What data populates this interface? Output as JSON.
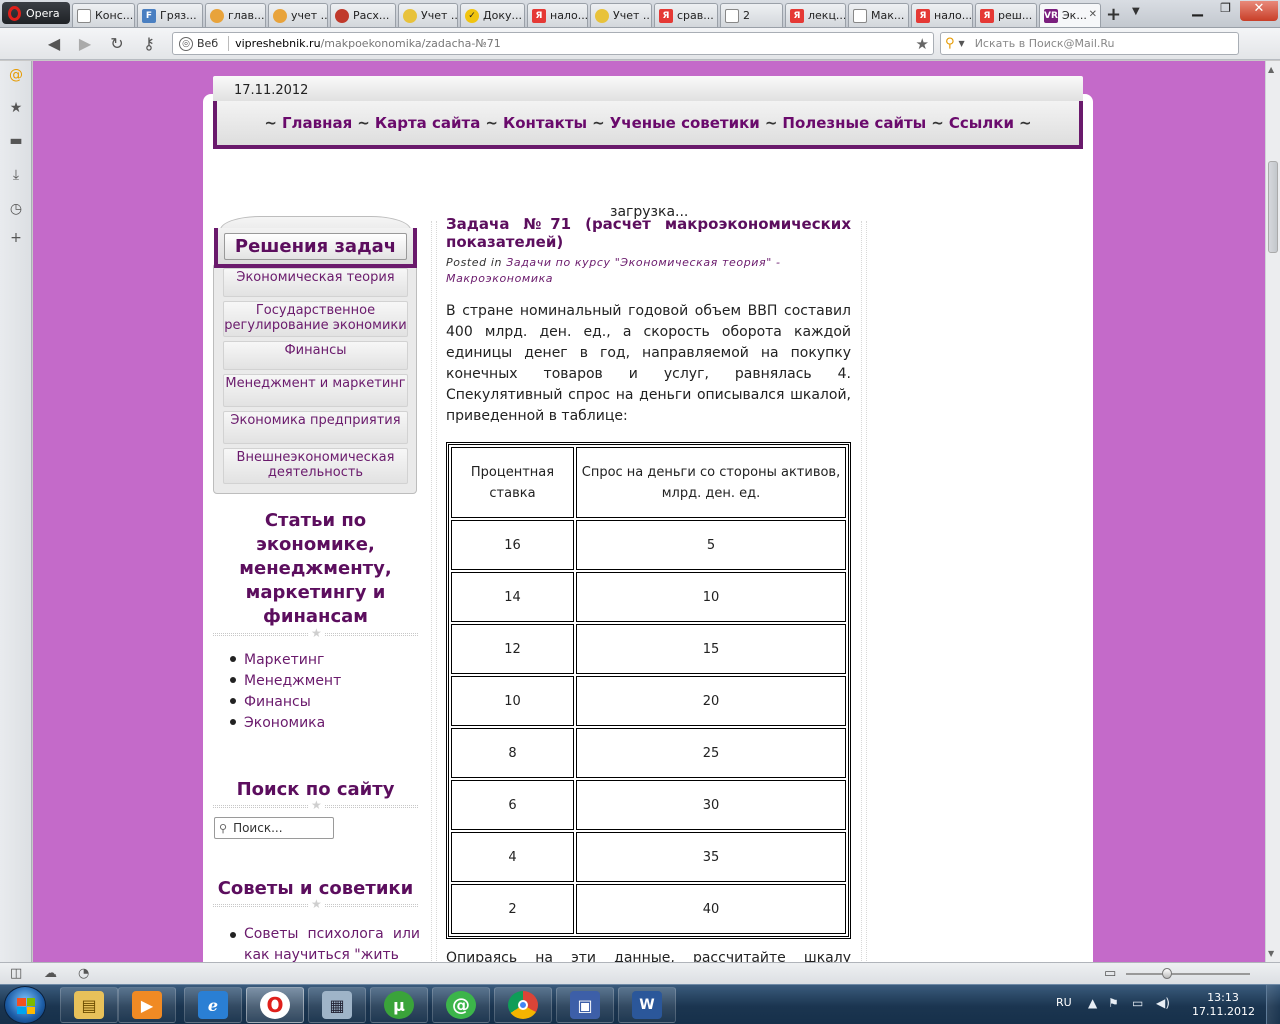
{
  "browser": {
    "menu_label": "Opera",
    "tabs": [
      {
        "label": "Конс...",
        "fav": "page",
        "color": "#ffffff"
      },
      {
        "label": "Гряз...",
        "fav": "F",
        "color": "#4a7fc1"
      },
      {
        "label": "глав...",
        "fav": "owl",
        "color": "#e8a33b"
      },
      {
        "label": "учет ...",
        "fav": "owl",
        "color": "#e8a33b"
      },
      {
        "label": "Расх...",
        "fav": "lifebuoy",
        "color": "#c0392b"
      },
      {
        "label": "Учет ...",
        "fav": "money",
        "color": "#e8c23b"
      },
      {
        "label": "Доку...",
        "fav": "check",
        "color": "#f1c40f"
      },
      {
        "label": "нало...",
        "fav": "Я",
        "color": "#e53935"
      },
      {
        "label": "Учет ...",
        "fav": "money",
        "color": "#e8c23b"
      },
      {
        "label": "срав...",
        "fav": "Я",
        "color": "#e53935"
      },
      {
        "label": "2",
        "fav": "page",
        "color": "#ffffff"
      },
      {
        "label": "лекц...",
        "fav": "Я",
        "color": "#e53935"
      },
      {
        "label": "Мак...",
        "fav": "page",
        "color": "#ffffff"
      },
      {
        "label": "нало...",
        "fav": "Я",
        "color": "#e53935"
      },
      {
        "label": "реш...",
        "fav": "Я",
        "color": "#e53935"
      },
      {
        "label": "Эк...",
        "fav": "VR",
        "color": "#7b1f7e"
      }
    ],
    "url_prefix": "Веб",
    "url_domain": "vipreshebnik.ru",
    "url_path": "/makpoekonomika/zadacha-№71",
    "search_placeholder": "Искать в Поиск@Mail.Ru"
  },
  "site": {
    "date": "17.11.2012",
    "nav": [
      "Главная",
      "Карта сайта",
      "Контакты",
      "Ученые советики",
      "Полезные сайты",
      "Ссылки"
    ],
    "nav_sep": "~",
    "loading_text": "загрузка...",
    "widget_title": "Решения задач",
    "categories": [
      "Экономическая теория",
      "Государственное регулирование экономики",
      "Финансы",
      "Менеджмент и маркетинг",
      "Экономика предприятия",
      "Внешнеэкономическая деятельность"
    ],
    "articles_heading": "Статьи по экономике, менеджменту, маркетингу и финансам",
    "articles": [
      "Маркетинг",
      "Менеджмент",
      "Финансы",
      "Экономика"
    ],
    "search_heading": "Поиск по сайту",
    "search_placeholder": "Поиск...",
    "tips_heading": "Советы и советики",
    "tips_text": "Советы психолога или как научиться \"жить",
    "post": {
      "title_line1": "Задача №71 (расчет макроэкономических",
      "title_line2": "показателей)",
      "meta_label": "Posted in",
      "meta_link": "Задачи по курсу \"Экономическая теория\" - Макроэкономика",
      "body": "В стране номинальный годовой объем ВВП составил 400 млрд. ден. ед., а скорость оборота каждой единицы денег в год, направляемой на покупку конечных товаров и услуг, равнялась 4. Спекулятивный спрос на деньги описывался шкалой, приведенной в таблице:",
      "table_headers": [
        "Процентная ставка",
        "Спрос на деньги со стороны активов, млрд. ден. ед."
      ],
      "table_rows": [
        [
          "16",
          "5"
        ],
        [
          "14",
          "10"
        ],
        [
          "12",
          "15"
        ],
        [
          "10",
          "20"
        ],
        [
          "8",
          "25"
        ],
        [
          "6",
          "30"
        ],
        [
          "4",
          "35"
        ],
        [
          "2",
          "40"
        ]
      ],
      "after_text": "Опираясь на эти данные, рассчитайте шкалу"
    }
  },
  "taskbar": {
    "lang": "RU",
    "time": "13:13",
    "date": "17.11.2012"
  }
}
